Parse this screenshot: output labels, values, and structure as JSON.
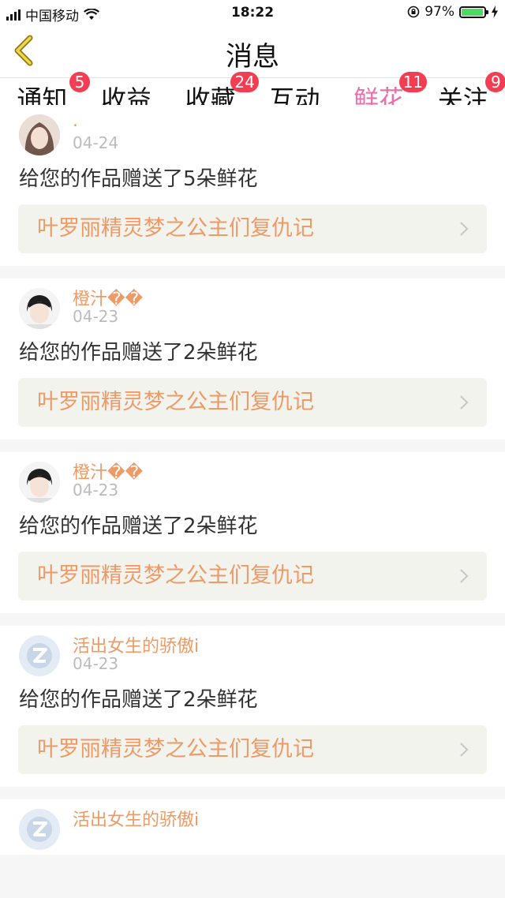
{
  "status_bar": {
    "carrier": "中国移动",
    "time": "18:22",
    "battery": "97%",
    "battery_level": 0.97
  },
  "header": {
    "title": "消息",
    "back_icon": "chevron-left-icon"
  },
  "tabs": [
    {
      "label": "通知",
      "badge": "5",
      "active": false
    },
    {
      "label": "收益",
      "badge": "",
      "active": false
    },
    {
      "label": "收藏",
      "badge": "24",
      "active": false
    },
    {
      "label": "互动",
      "badge": "",
      "active": false
    },
    {
      "label": "鲜花",
      "badge": "11",
      "active": true
    },
    {
      "label": "关注",
      "badge": "9",
      "active": false
    }
  ],
  "colors": {
    "accent_pink": "#e971a9",
    "badge_red": "#f23d52",
    "username_orange": "#ee9a66"
  },
  "messages": [
    {
      "user": ".",
      "date": "04-24",
      "text": "给您的作品赠送了5朵鲜花",
      "work": "叶罗丽精灵梦之公主们复仇记",
      "avatar": "girl-photo"
    },
    {
      "user": "橙汁��",
      "date": "04-23",
      "text": "给您的作品赠送了2朵鲜花",
      "work": "叶罗丽精灵梦之公主们复仇记",
      "avatar": "boy-photo"
    },
    {
      "user": "橙汁��",
      "date": "04-23",
      "text": "给您的作品赠送了2朵鲜花",
      "work": "叶罗丽精灵梦之公主们复仇记",
      "avatar": "boy-photo"
    },
    {
      "user": "活出女生的骄傲i",
      "date": "04-23",
      "text": "给您的作品赠送了2朵鲜花",
      "work": "叶罗丽精灵梦之公主们复仇记",
      "avatar": "default-avatar"
    },
    {
      "user": "活出女生的骄傲i",
      "date": "",
      "text": "",
      "work": "",
      "avatar": "default-avatar"
    }
  ]
}
